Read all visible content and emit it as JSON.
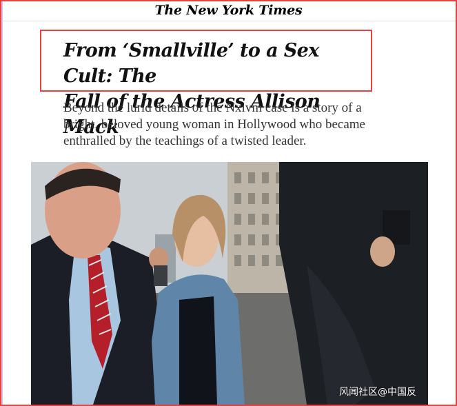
{
  "masthead": {
    "logo_text": "The New York Times"
  },
  "article": {
    "headline_line1": "From ‘Smallville’ to a Sex Cult: The",
    "headline_line2": "Fall of the Actress Allison Mack",
    "summary_line1": "Beyond the lurid details of the Nxivm case is a story of a",
    "summary_line2": "bright, beloved young woman in Hollywood who became",
    "summary_line3": "enthralled by the teachings of a twisted leader."
  },
  "watermark": "风闻社区@中国反",
  "colors": {
    "highlight": "#e8403f",
    "headline": "#121212",
    "summary": "#333333"
  }
}
